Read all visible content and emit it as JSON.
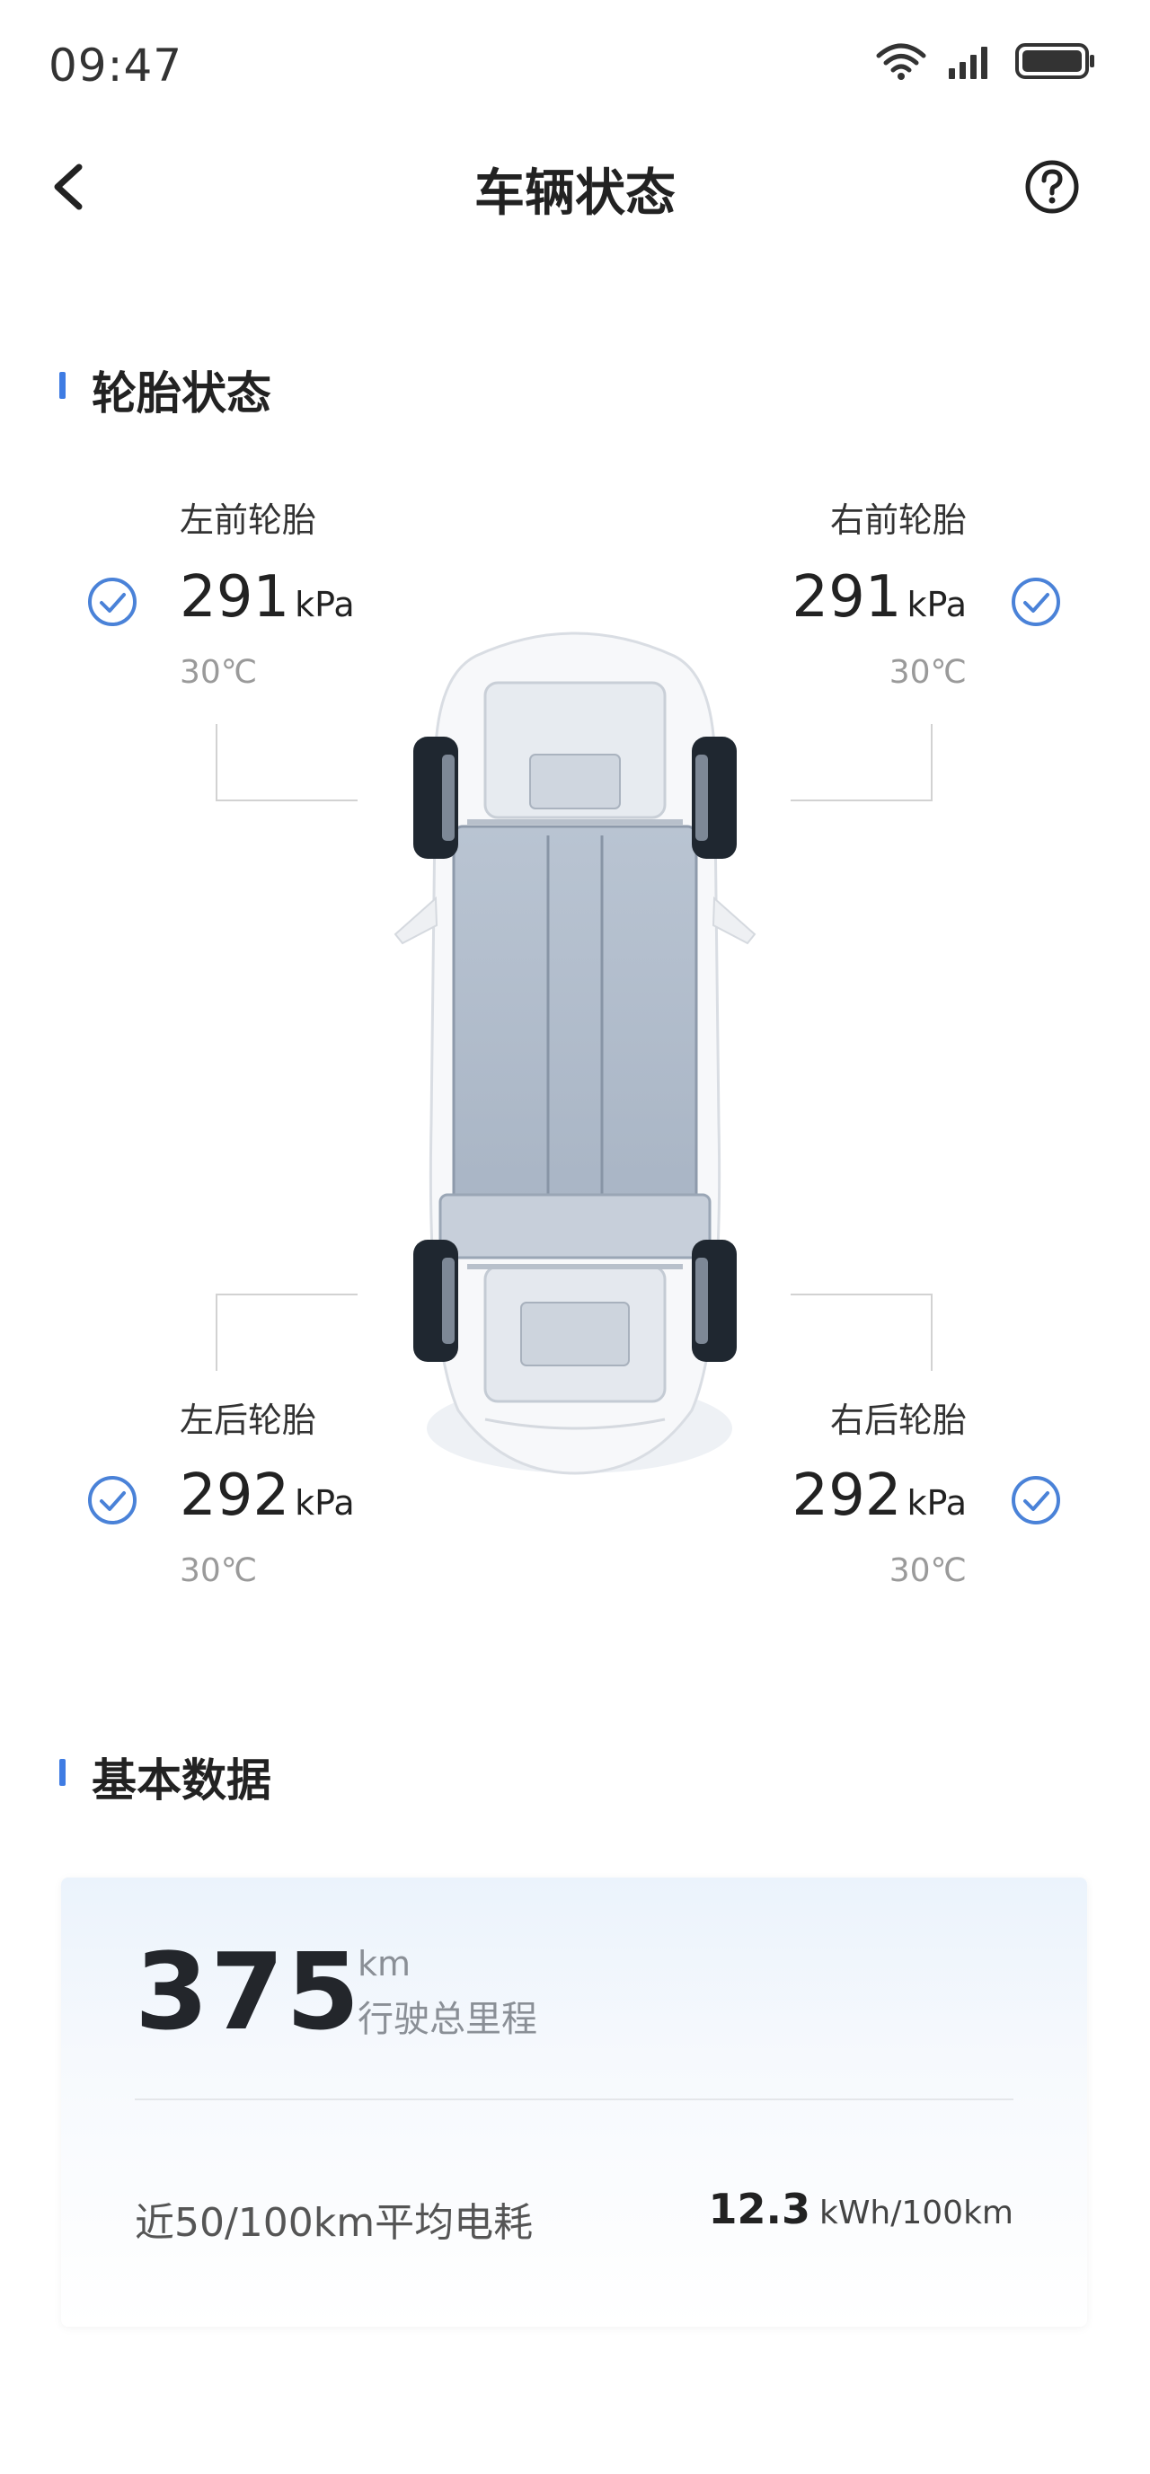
{
  "status_bar": {
    "time": "09:47"
  },
  "header": {
    "title": "车辆状态"
  },
  "tire_section": {
    "title": "轮胎状态",
    "tires": {
      "front_left": {
        "name": "左前轮胎",
        "pressure": "291",
        "unit": "kPa",
        "temp": "30℃"
      },
      "front_right": {
        "name": "右前轮胎",
        "pressure": "291",
        "unit": "kPa",
        "temp": "30℃"
      },
      "rear_left": {
        "name": "左后轮胎",
        "pressure": "292",
        "unit": "kPa",
        "temp": "30℃"
      },
      "rear_right": {
        "name": "右后轮胎",
        "pressure": "292",
        "unit": "kPa",
        "temp": "30℃"
      }
    }
  },
  "basic_section": {
    "title": "基本数据",
    "mileage": {
      "value": "375",
      "unit": "km",
      "label": "行驶总里程"
    },
    "consumption": {
      "label": "近50/100km平均电耗",
      "value": "12.3",
      "unit": "kWh/100km"
    }
  },
  "icons": {
    "wifi": "wifi-icon",
    "signal": "signal-icon",
    "battery": "battery-icon",
    "back": "chevron-left-icon",
    "help": "help-circle-icon",
    "check": "check-circle-icon"
  },
  "colors": {
    "accent": "#3f7ce3",
    "check": "#4a82d8"
  }
}
